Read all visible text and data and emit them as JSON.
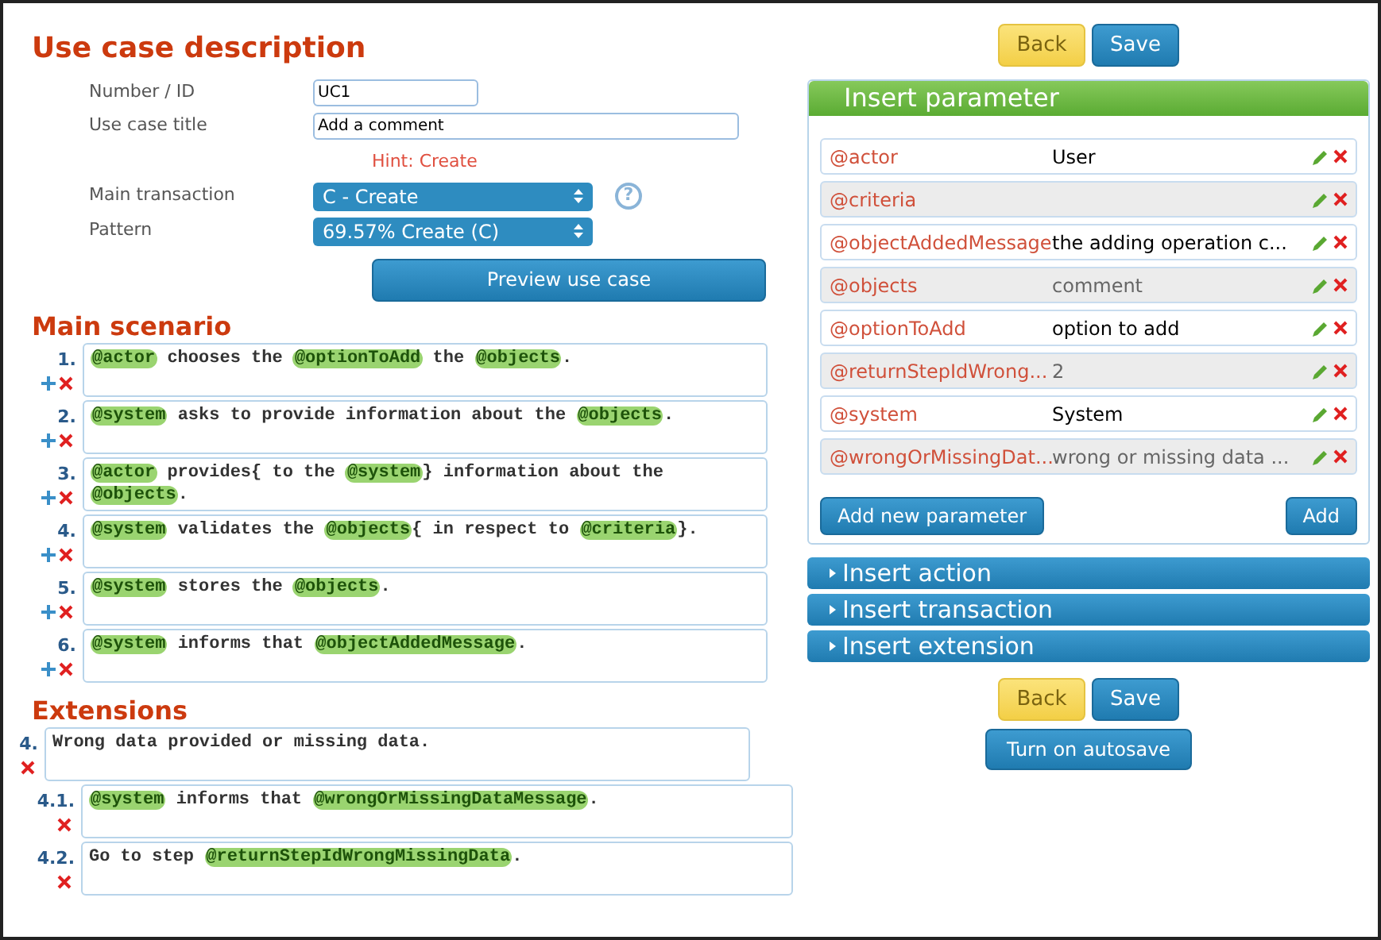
{
  "description": {
    "title": "Use case description",
    "fields": [
      {
        "label": "Number / ID",
        "value": "UC1",
        "kind": "short"
      },
      {
        "label": "Use case title",
        "value": "Add a comment",
        "kind": "wide"
      }
    ],
    "hint": "Hint: Create",
    "selects": [
      {
        "label": "Main transaction",
        "value": "C - Create",
        "help": "?"
      },
      {
        "label": "Pattern",
        "value": "69.57% Create (C)"
      }
    ],
    "preview_button": "Preview use case"
  },
  "main_scenario": {
    "title": "Main scenario",
    "steps": [
      {
        "number": "1.",
        "segments": [
          {
            "kind": "param",
            "text": "@actor"
          },
          {
            "kind": "text",
            "text": " chooses the "
          },
          {
            "kind": "param",
            "text": "@optionToAdd"
          },
          {
            "kind": "text",
            "text": " the "
          },
          {
            "kind": "param",
            "text": "@objects"
          },
          {
            "kind": "text",
            "text": "."
          }
        ]
      },
      {
        "number": "2.",
        "segments": [
          {
            "kind": "param",
            "text": "@system"
          },
          {
            "kind": "text",
            "text": " asks to provide information about the "
          },
          {
            "kind": "param",
            "text": "@objects"
          },
          {
            "kind": "text",
            "text": "."
          }
        ]
      },
      {
        "number": "3.",
        "segments": [
          {
            "kind": "param",
            "text": "@actor"
          },
          {
            "kind": "text",
            "text": " provides{ to the "
          },
          {
            "kind": "param",
            "text": "@system"
          },
          {
            "kind": "text",
            "text": "} information about the "
          },
          {
            "kind": "param",
            "text": "@objects"
          },
          {
            "kind": "text",
            "text": "."
          }
        ]
      },
      {
        "number": "4.",
        "segments": [
          {
            "kind": "param",
            "text": "@system"
          },
          {
            "kind": "text",
            "text": " validates the "
          },
          {
            "kind": "param",
            "text": "@objects"
          },
          {
            "kind": "text",
            "text": "{ in respect to "
          },
          {
            "kind": "param",
            "text": "@criteria"
          },
          {
            "kind": "text",
            "text": "}."
          }
        ]
      },
      {
        "number": "5.",
        "segments": [
          {
            "kind": "param",
            "text": "@system"
          },
          {
            "kind": "text",
            "text": " stores the "
          },
          {
            "kind": "param",
            "text": "@objects"
          },
          {
            "kind": "text",
            "text": "."
          }
        ]
      },
      {
        "number": "6.",
        "segments": [
          {
            "kind": "param",
            "text": "@system"
          },
          {
            "kind": "text",
            "text": " informs that "
          },
          {
            "kind": "param",
            "text": "@objectAddedMessage"
          },
          {
            "kind": "text",
            "text": "."
          }
        ]
      }
    ]
  },
  "extensions": {
    "title": "Extensions",
    "items": [
      {
        "number": "4.",
        "segments": [
          {
            "kind": "text",
            "text": "Wrong data provided or missing data."
          }
        ],
        "children": [
          {
            "number": "4.1.",
            "segments": [
              {
                "kind": "param",
                "text": "@system"
              },
              {
                "kind": "text",
                "text": " informs that "
              },
              {
                "kind": "param",
                "text": "@wrongOrMissingDataMessage"
              },
              {
                "kind": "text",
                "text": "."
              }
            ]
          },
          {
            "number": "4.2.",
            "segments": [
              {
                "kind": "text",
                "text": "Go to step "
              },
              {
                "kind": "param",
                "text": "@returnStepIdWrongMissingData"
              },
              {
                "kind": "text",
                "text": "."
              }
            ]
          }
        ]
      }
    ]
  },
  "top_buttons": [
    {
      "label": "Back",
      "kind": "back"
    },
    {
      "label": "Save",
      "kind": "save"
    }
  ],
  "insert_parameter": {
    "title": "Insert parameter",
    "parameters": [
      {
        "name": "@actor",
        "value": "User",
        "custom": true
      },
      {
        "name": "@criteria"
      },
      {
        "name": "@objectAddedMessage",
        "value": "the adding operation c...",
        "custom": true
      },
      {
        "name": "@objects",
        "value": "comment",
        "custom": false
      },
      {
        "name": "@optionToAdd",
        "value": "option to add",
        "custom": true
      },
      {
        "name": "@returnStepIdWrong...",
        "value": "2",
        "custom": false
      },
      {
        "name": "@system",
        "value": "System",
        "custom": true
      },
      {
        "name": "@wrongOrMissingDat...",
        "value": "wrong or missing data ...",
        "custom": false
      }
    ],
    "buttons": [
      "Add new parameter",
      "Add"
    ]
  },
  "sections": [
    {
      "label": "Insert action",
      "expanded": false
    },
    {
      "label": "Insert transaction",
      "expanded": false
    },
    {
      "label": "Insert extension",
      "expanded": false
    }
  ],
  "bottom_buttons": [
    {
      "label": "Back",
      "kind": "back"
    },
    {
      "label": "Save",
      "kind": "save"
    }
  ],
  "autosave_button": "Turn on autosave"
}
